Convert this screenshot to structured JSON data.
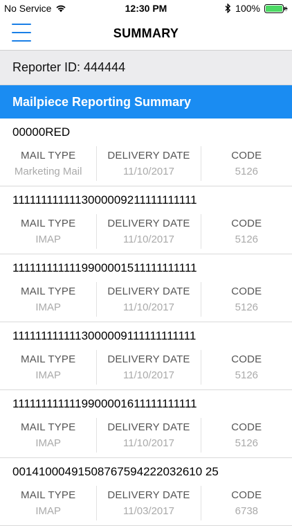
{
  "status_bar": {
    "carrier": "No Service",
    "time": "12:30 PM",
    "battery": "100%"
  },
  "nav": {
    "title": "SUMMARY"
  },
  "reporter": {
    "text": "Reporter ID: 444444"
  },
  "section": {
    "title": "Mailpiece Reporting Summary"
  },
  "labels": {
    "mail_type": "MAIL TYPE",
    "delivery_date": "DELIVERY DATE",
    "code": "CODE"
  },
  "records": [
    {
      "id": "00000RED",
      "mail_type": "Marketing Mail",
      "delivery_date": "11/10/2017",
      "code": "5126"
    },
    {
      "id": "1111111111113000009211111111111",
      "mail_type": "IMAP",
      "delivery_date": "11/10/2017",
      "code": "5126"
    },
    {
      "id": "1111111111119900001511111111111",
      "mail_type": "IMAP",
      "delivery_date": "11/10/2017",
      "code": "5126"
    },
    {
      "id": "1111111111113000009111111111111",
      "mail_type": "IMAP",
      "delivery_date": "11/10/2017",
      "code": "5126"
    },
    {
      "id": "1111111111119900001611111111111",
      "mail_type": "IMAP",
      "delivery_date": "11/10/2017",
      "code": "5126"
    },
    {
      "id": "00141000491508767594222032610 25",
      "mail_type": "IMAP",
      "delivery_date": "11/03/2017",
      "code": "6738"
    }
  ],
  "colors": {
    "accent": "#1a8cf2",
    "battery": "#4cd964"
  }
}
